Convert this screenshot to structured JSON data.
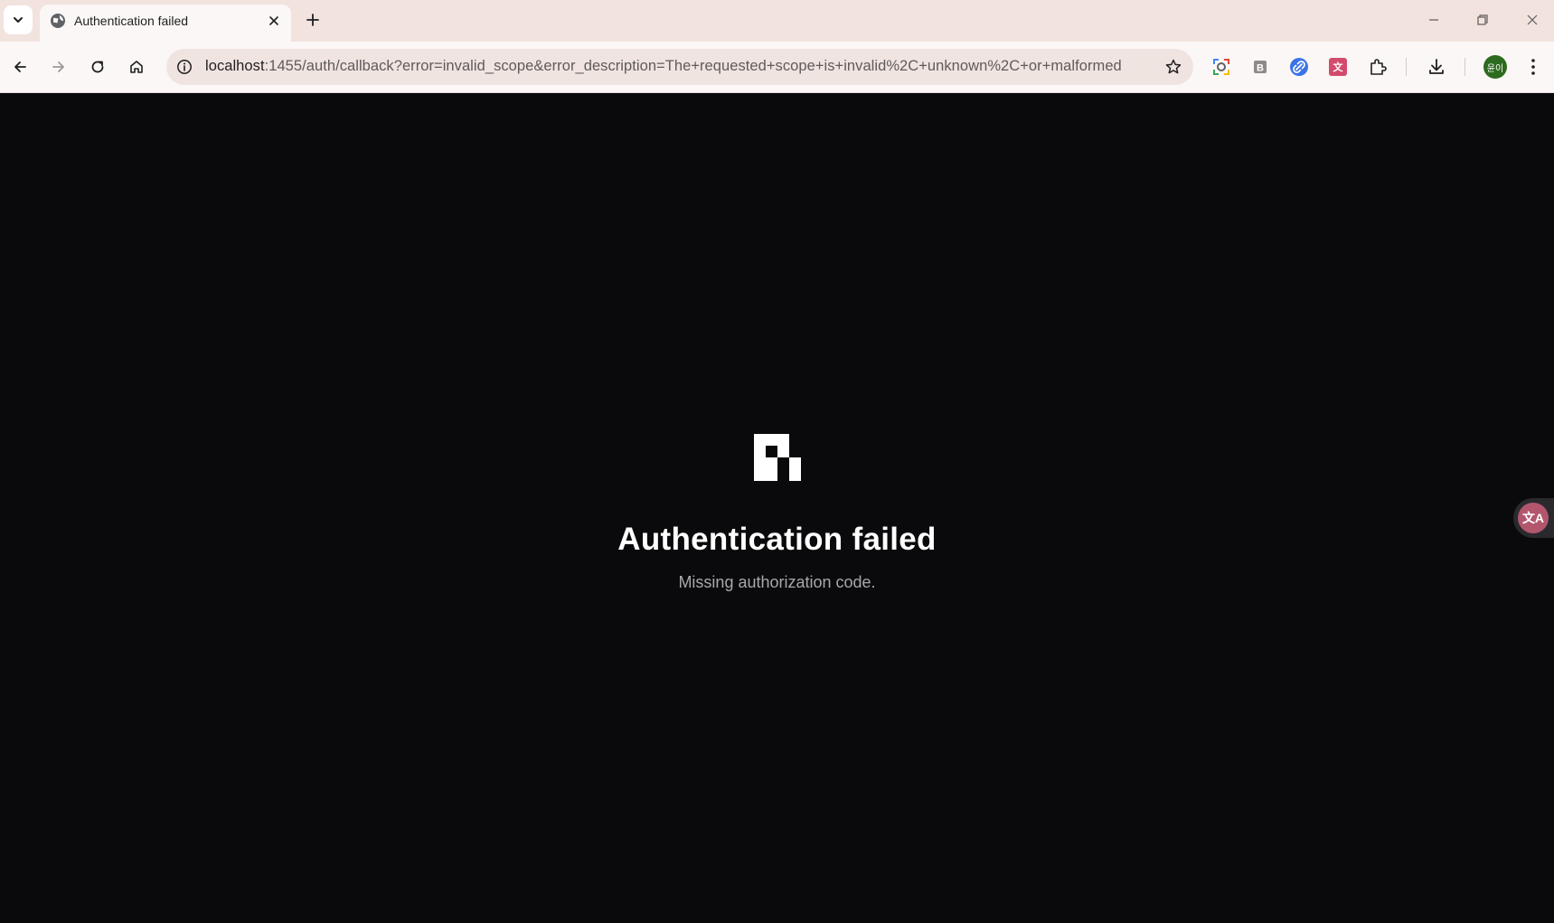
{
  "browser": {
    "tab": {
      "title": "Authentication failed",
      "favicon": "globe-icon"
    },
    "window_controls": [
      "minimize-icon",
      "restore-icon",
      "close-icon"
    ],
    "omnibox": {
      "url_host": "localhost",
      "url_rest": ":1455/auth/callback?error=invalid_scope&error_description=The+requested+scope+is+invalid%2C+unknown%2C+or+malformed",
      "info_icon": "info-icon",
      "bookmark_icon": "star-icon"
    },
    "extensions": [
      "lens-icon",
      "b-extension-icon",
      "link-extension-icon",
      "translate-extension-icon",
      "puzzle-icon"
    ],
    "avatar_label": "윤이",
    "colors": {
      "tab_strip": "#f2e3df",
      "toolbar": "#fbf7f6",
      "avatar": "#2d6b1f"
    }
  },
  "page": {
    "logo": "app-logo",
    "title": "Authentication failed",
    "message": "Missing authorization code.",
    "side_button_icon": "translate-icon",
    "colors": {
      "background": "#0a0a0c",
      "title": "#ffffff",
      "message": "#a8a8ad"
    }
  }
}
